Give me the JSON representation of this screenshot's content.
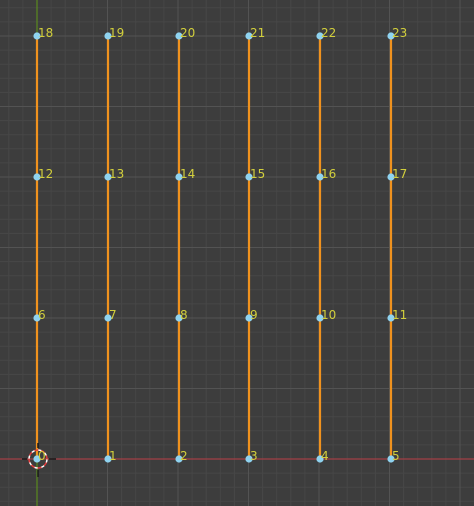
{
  "viewport": {
    "background_color": "#3d3d3d",
    "grid_minor_color": "#474747",
    "grid_major_color": "#535353",
    "x_axis_color": "#a33f45",
    "y_axis_color": "#5a8a1f"
  },
  "mesh": {
    "edge_color": "#f0921e",
    "vertex_color": "#8fd3f0",
    "label_color": "#d2cf3c",
    "columns": 6,
    "rows": 4,
    "vertex_labels": [
      "0",
      "1",
      "2",
      "3",
      "4",
      "5",
      "6",
      "7",
      "8",
      "9",
      "10",
      "11",
      "12",
      "13",
      "14",
      "15",
      "16",
      "17",
      "18",
      "19",
      "20",
      "21",
      "22",
      "23"
    ]
  },
  "cursor": {
    "icon": "3d-cursor-icon"
  }
}
